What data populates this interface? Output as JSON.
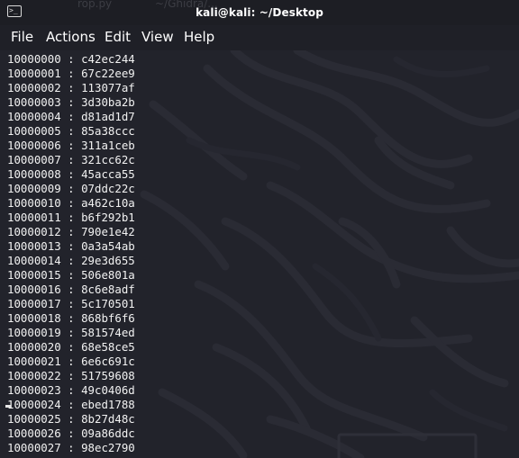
{
  "window": {
    "title": "kali@kali: ~/Desktop",
    "icon": "terminal-icon",
    "icon_glyph": ">_",
    "ghost_tabs": [
      "rop.py",
      "~/Ghidra/..."
    ]
  },
  "menu": [
    {
      "label": "File"
    },
    {
      "label": "Actions"
    },
    {
      "label": "Edit"
    },
    {
      "label": "View"
    },
    {
      "label": "Help"
    }
  ],
  "terminal": {
    "lines": [
      {
        "addr": "10000000",
        "value": "c42ec244"
      },
      {
        "addr": "10000001",
        "value": "67c22ee9"
      },
      {
        "addr": "10000002",
        "value": "113077af"
      },
      {
        "addr": "10000003",
        "value": "3d30ba2b"
      },
      {
        "addr": "10000004",
        "value": "d81ad1d7"
      },
      {
        "addr": "10000005",
        "value": "85a38ccc"
      },
      {
        "addr": "10000006",
        "value": "311a1ceb"
      },
      {
        "addr": "10000007",
        "value": "321cc62c"
      },
      {
        "addr": "10000008",
        "value": "45acca55"
      },
      {
        "addr": "10000009",
        "value": "07ddc22c"
      },
      {
        "addr": "10000010",
        "value": "a462c10a"
      },
      {
        "addr": "10000011",
        "value": "b6f292b1"
      },
      {
        "addr": "10000012",
        "value": "790e1e42"
      },
      {
        "addr": "10000013",
        "value": "0a3a54ab"
      },
      {
        "addr": "10000014",
        "value": "29e3d655"
      },
      {
        "addr": "10000015",
        "value": "506e801a"
      },
      {
        "addr": "10000016",
        "value": "8c6e8adf"
      },
      {
        "addr": "10000017",
        "value": "5c170501"
      },
      {
        "addr": "10000018",
        "value": "868bf6f6"
      },
      {
        "addr": "10000019",
        "value": "581574ed"
      },
      {
        "addr": "10000020",
        "value": "68e58ce5"
      },
      {
        "addr": "10000021",
        "value": "6e6c691c"
      },
      {
        "addr": "10000022",
        "value": "51759608"
      },
      {
        "addr": "10000023",
        "value": "49c0406d"
      },
      {
        "addr": "10000024",
        "value": "ebed1788"
      },
      {
        "addr": "10000025",
        "value": "8b27d48c"
      },
      {
        "addr": "10000026",
        "value": "09a86ddc"
      },
      {
        "addr": "10000027",
        "value": "98ec2790"
      }
    ],
    "separator": " : "
  },
  "colors": {
    "background": "#22232b",
    "text": "#f2f2f2",
    "swirl": "#2b2c35"
  }
}
